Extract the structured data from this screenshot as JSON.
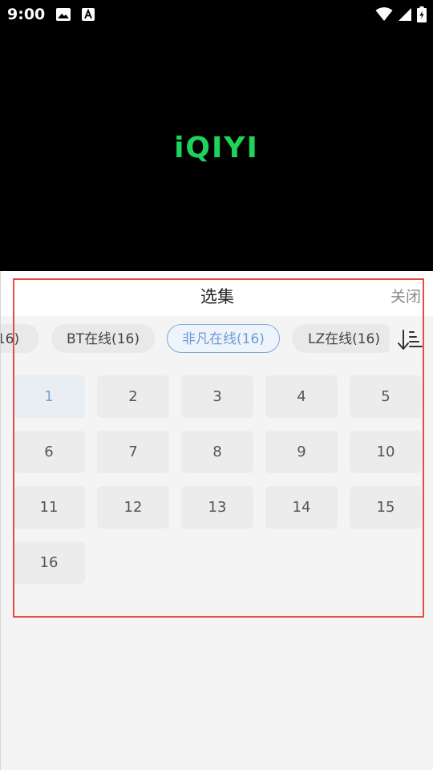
{
  "status_bar": {
    "time": "9:00",
    "left_icons": [
      "image-icon",
      "text-a-icon"
    ],
    "right_icons": [
      "wifi-icon",
      "signal-icon",
      "battery-icon"
    ]
  },
  "player": {
    "logo_text": "iQIYI",
    "logo_color": "#1ed35a"
  },
  "panel": {
    "title": "选集",
    "close_label": "关闭",
    "sources": [
      {
        "label": "16)",
        "active": false
      },
      {
        "label": "BT在线(16)",
        "active": false
      },
      {
        "label": "非凡在线(16)",
        "active": true
      },
      {
        "label": "LZ在线(16)",
        "active": false
      }
    ],
    "sort_icon": "sort-descending-icon",
    "episodes": [
      "1",
      "2",
      "3",
      "4",
      "5",
      "6",
      "7",
      "8",
      "9",
      "10",
      "11",
      "12",
      "13",
      "14",
      "15",
      "16"
    ],
    "selected_episode": "1",
    "accent_color": "#6d9bd6"
  }
}
